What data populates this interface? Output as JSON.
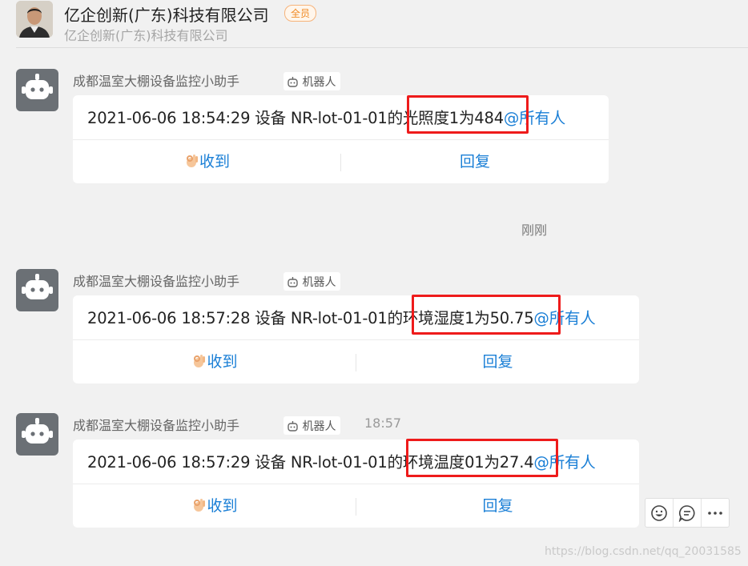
{
  "header": {
    "title": "亿企创新(广东)科技有限公司",
    "badge": "全员",
    "subtitle": "亿企创新(广东)科技有限公司"
  },
  "messages": [
    {
      "sender": "成都温室大棚设备监控小助手",
      "robot_tag": "机器人",
      "time": "",
      "text": "2021-06-06 18:54:29 设备 NR-lot-01-01的光照度1为484",
      "mention": "@所有人",
      "ack_label": "收到",
      "reply_label": "回复"
    },
    {
      "sender": "成都温室大棚设备监控小助手",
      "robot_tag": "机器人",
      "time": "",
      "text": "2021-06-06 18:57:28 设备 NR-lot-01-01的环境湿度1为50.75",
      "mention": "@所有人",
      "ack_label": "收到",
      "reply_label": "回复"
    },
    {
      "sender": "成都温室大棚设备监控小助手",
      "robot_tag": "机器人",
      "time": "18:57",
      "text": "2021-06-06 18:57:29 设备 NR-lot-01-01的环境温度01为27.4",
      "mention": "@所有人",
      "ack_label": "收到",
      "reply_label": "回复"
    }
  ],
  "divider_time": "刚刚",
  "hover_actions": [
    "emoji-icon",
    "reply-bubble-icon",
    "more-icon"
  ],
  "watermark": "https://blog.csdn.net/qq_20031585",
  "colors": {
    "accent": "#1a7fd6",
    "highlight_box": "#ee1b1b",
    "badge": "#f08a24",
    "background": "#f1f1f1"
  }
}
